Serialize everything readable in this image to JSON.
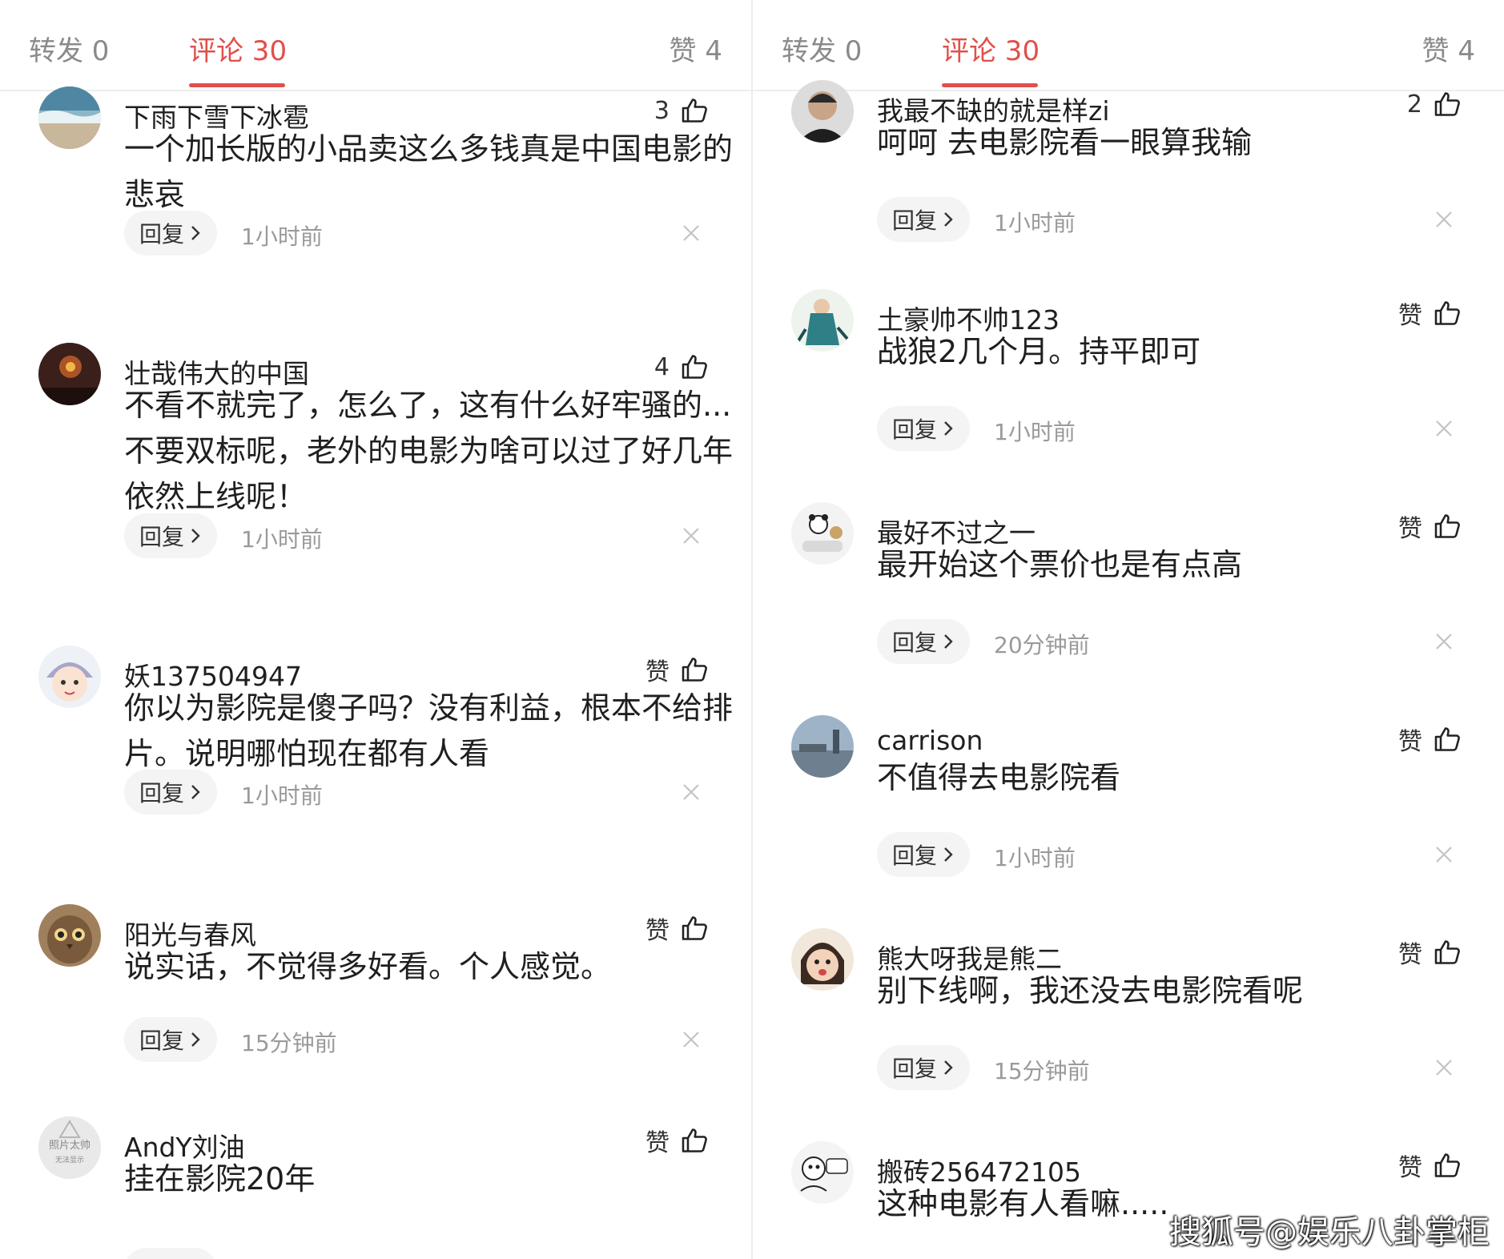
{
  "left_panel": {
    "tabs": {
      "share": "转发 0",
      "comments": "评论 30",
      "likes": "赞 4"
    },
    "comments": [
      {
        "username": "下雨下雪下冰雹",
        "likes": "3",
        "text": "一个加长版的小品卖这么多钱真是中国电影的悲哀",
        "reply": "回复",
        "time": "1小时前",
        "avatar": "waves"
      },
      {
        "username": "壮哉伟大的中国",
        "likes": "4",
        "text": "不看不就完了，怎么了，这有什么好牢骚的...不要双标呢，老外的电影为啥可以过了好几年依然上线呢！",
        "reply": "回复",
        "time": "1小时前",
        "avatar": "night"
      },
      {
        "username": "妖137504947",
        "likes": "赞",
        "text": "你以为影院是傻子吗？没有利益，根本不给排片。说明哪怕现在都有人看",
        "reply": "回复",
        "time": "1小时前",
        "avatar": "cartoon"
      },
      {
        "username": "阳光与春风",
        "likes": "赞",
        "text": "说实话，不觉得多好看。个人感觉。",
        "reply": "回复",
        "time": "15分钟前",
        "avatar": "owl"
      },
      {
        "username": "AndY刘油",
        "likes": "赞",
        "text": "挂在影院20年",
        "reply": "",
        "time": "",
        "avatar": "placeholder",
        "avatar_text": "照片太帅",
        "avatar_subtext": "无法显示"
      }
    ]
  },
  "right_panel": {
    "tabs": {
      "share": "转发 0",
      "comments": "评论 30",
      "likes": "赞 4"
    },
    "comments": [
      {
        "username": "我最不缺的就是样zi",
        "likes": "2",
        "text": "呵呵 去电影院看一眼算我输",
        "reply": "回复",
        "time": "1小时前",
        "avatar": "man"
      },
      {
        "username": "土豪帅不帅123",
        "likes": "赞",
        "text": "战狼2几个月。持平即可",
        "reply": "回复",
        "time": "1小时前",
        "avatar": "figure"
      },
      {
        "username": "最好不过之一",
        "likes": "赞",
        "text": "最开始这个票价也是有点高",
        "reply": "回复",
        "time": "20分钟前",
        "avatar": "panda"
      },
      {
        "username": "carrison",
        "likes": "赞",
        "text": "不值得去电影院看",
        "reply": "回复",
        "time": "1小时前",
        "avatar": "city"
      },
      {
        "username": "熊大呀我是熊二",
        "likes": "赞",
        "text": "别下线啊，我还没去电影院看呢",
        "reply": "回复",
        "time": "15分钟前",
        "avatar": "child"
      },
      {
        "username": "搬砖256472105",
        "likes": "赞",
        "text": "这种电影有人看嘛.....",
        "reply": "",
        "time": "",
        "avatar": "sketch"
      }
    ]
  },
  "watermark": "搜狐号@娱乐八卦掌柜",
  "colors": {
    "accent": "#e0504a",
    "muted": "#9a9a9a",
    "reply_bg": "#f4f4f4"
  },
  "icons": {
    "like": "thumb-up-icon",
    "close": "close-icon",
    "reply_arrow": "chevron-right-icon"
  }
}
